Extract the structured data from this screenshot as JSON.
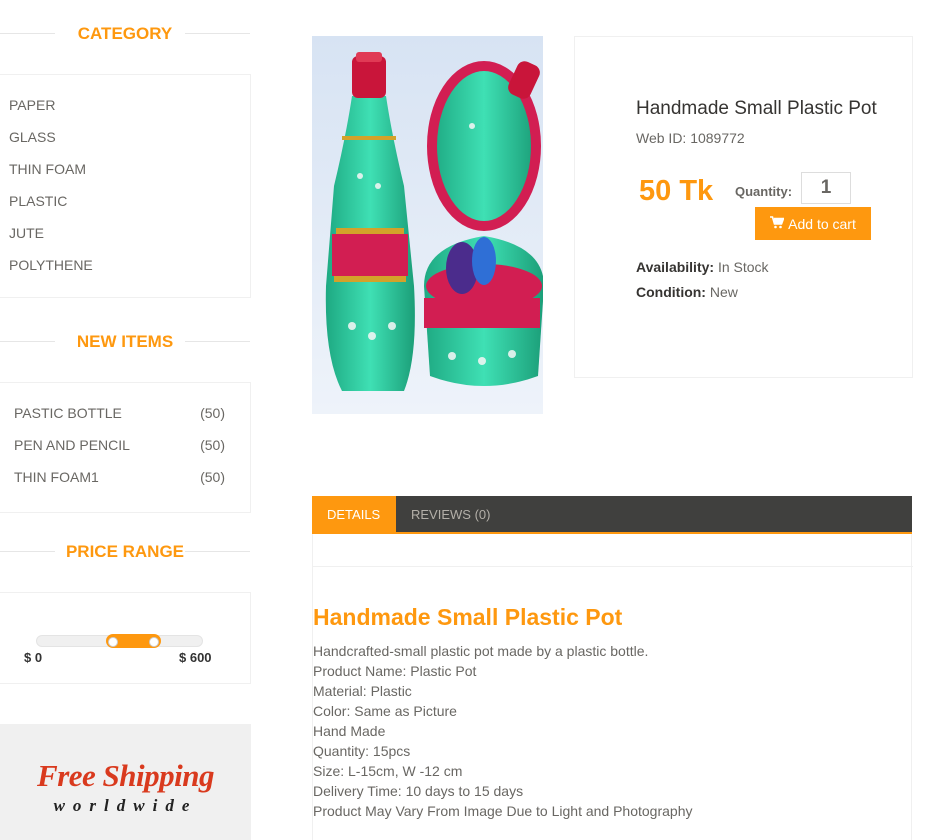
{
  "sidebar": {
    "category_title": "CATEGORY",
    "categories": [
      "PAPER",
      "GLASS",
      "THIN FOAM",
      "PLASTIC",
      "JUTE",
      "POLYTHENE"
    ],
    "new_items_title": "NEW ITEMS",
    "new_items": [
      {
        "label": "PASTIC BOTTLE",
        "count": "(50)"
      },
      {
        "label": "PEN AND PENCIL",
        "count": "(50)"
      },
      {
        "label": "THIN FOAM1",
        "count": "(50)"
      }
    ],
    "price_range_title": "PRICE RANGE",
    "price_min_label": "$ 0",
    "price_max_label": "$ 600",
    "shipping_line1": "Free Shipping",
    "shipping_line2": "worldwide"
  },
  "product": {
    "title": "Handmade Small Plastic Pot",
    "web_id": "Web ID: 1089772",
    "price": "50 Tk",
    "quantity_label": "Quantity:",
    "quantity_value": "1",
    "add_to_cart": "Add to cart",
    "availability_label": "Availability:",
    "availability_value": "In Stock",
    "condition_label": "Condition:",
    "condition_value": "New"
  },
  "tabs": [
    {
      "label": "DETAILS",
      "active": true
    },
    {
      "label": "REVIEWS (0)",
      "active": false
    }
  ],
  "details": {
    "heading": "Handmade Small Plastic Pot",
    "lines": [
      "Handcrafted-small plastic pot made by a plastic bottle.",
      "Product Name: Plastic Pot",
      "Material: Plastic",
      "Color: Same as Picture",
      "Hand Made",
      "Quantity: 15pcs",
      "Size: L-15cm, W -12 cm",
      "Delivery Time: 10 days to 15 days",
      "Product May Vary From Image Due to Light and Photography"
    ]
  },
  "colors": {
    "accent": "#fe980f",
    "tab_bar": "#40403e",
    "shipping_red": "#d93a1e"
  },
  "icons": [
    "shopping-cart-icon"
  ]
}
